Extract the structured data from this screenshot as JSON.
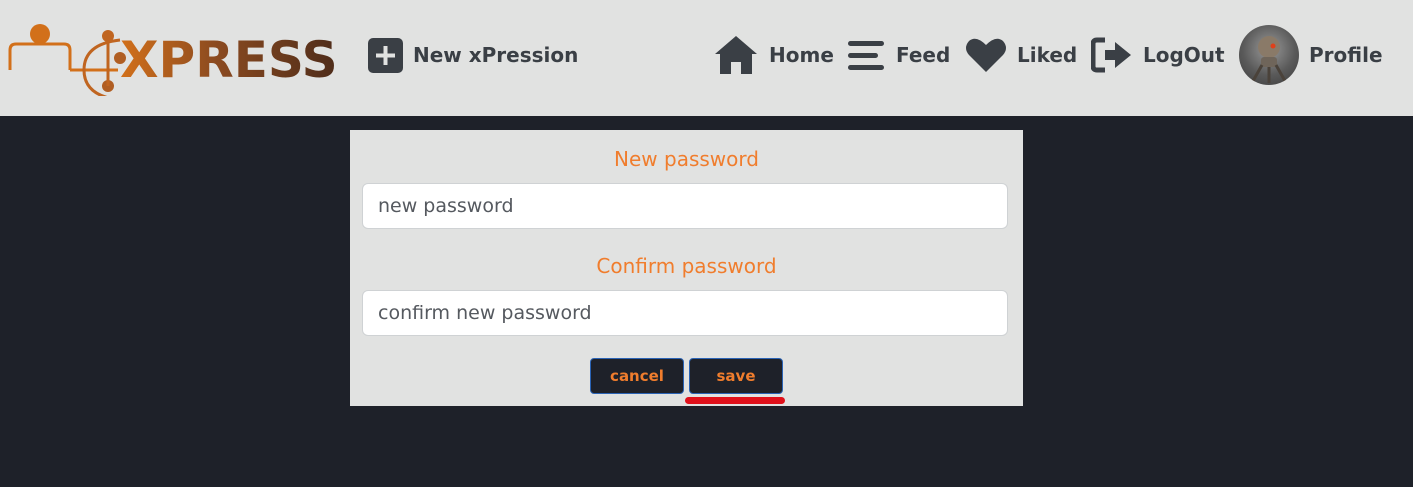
{
  "brand": {
    "logo_text": "XPRESS",
    "accent": "#d2701a",
    "dark": "#4e2c1a"
  },
  "nav": {
    "new_label": "New xPression",
    "home_label": "Home",
    "feed_label": "Feed",
    "liked_label": "Liked",
    "logout_label": "LogOut",
    "profile_label": "Profile",
    "icons": [
      "plus-square-icon",
      "home-icon",
      "bars-icon",
      "heart-icon",
      "logout-icon",
      "avatar"
    ]
  },
  "form": {
    "new_label": "New password",
    "new_placeholder": "new password",
    "new_value": "",
    "confirm_label": "Confirm password",
    "confirm_placeholder": "confirm new password",
    "confirm_value": "",
    "cancel_label": "cancel",
    "save_label": "save"
  },
  "colors": {
    "label": "#f07d2d",
    "background": "#1e2129",
    "panel": "#e1e2e1",
    "highlight": "#e0101a"
  }
}
